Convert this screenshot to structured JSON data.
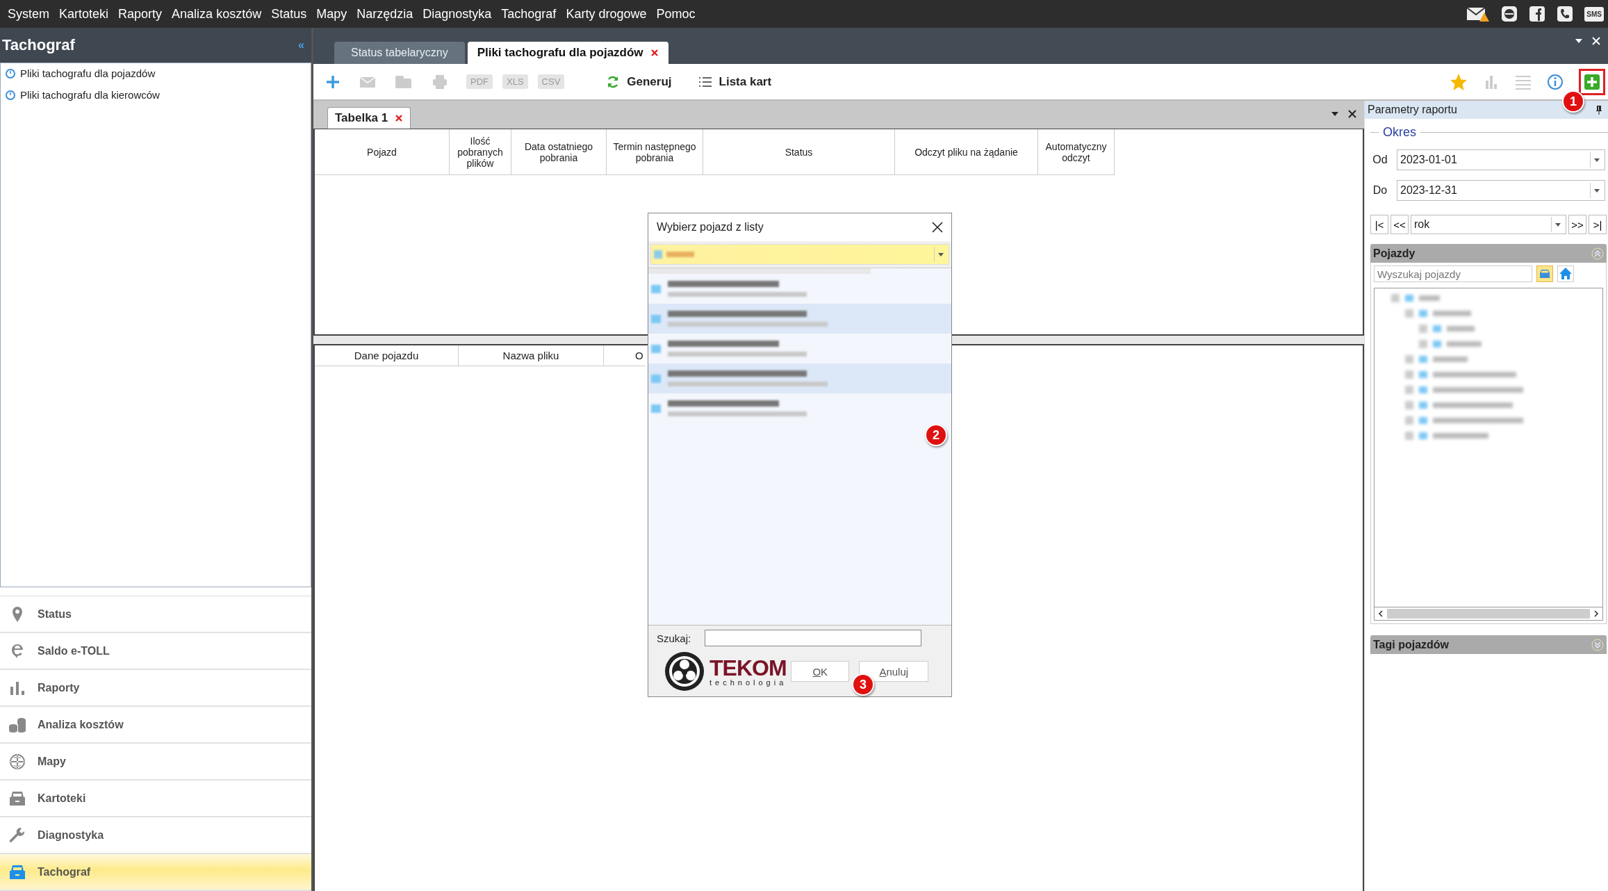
{
  "menu": [
    {
      "label": "System"
    },
    {
      "label": "Kartoteki"
    },
    {
      "label": "Raporty"
    },
    {
      "label": "Analiza kosztów"
    },
    {
      "label": "Status"
    },
    {
      "label": "Mapy"
    },
    {
      "label": "Narzędzia"
    },
    {
      "label": "Diagnostyka"
    },
    {
      "label": "Tachograf"
    },
    {
      "label": "Karty drogowe"
    },
    {
      "label": "Pomoc"
    }
  ],
  "sms_label": "SMS",
  "left_panel": {
    "title": "Tachograf",
    "collapse": "«",
    "items": [
      {
        "label": "Pliki tachografu dla pojazdów"
      },
      {
        "label": "Pliki tachografu dla kierowców"
      }
    ]
  },
  "nav": [
    {
      "label": "Status",
      "selected": false
    },
    {
      "label": "Saldo e-TOLL",
      "selected": false
    },
    {
      "label": "Raporty",
      "selected": false
    },
    {
      "label": "Analiza kosztów",
      "selected": false
    },
    {
      "label": "Mapy",
      "selected": false
    },
    {
      "label": "Kartoteki",
      "selected": false
    },
    {
      "label": "Diagnostyka",
      "selected": false
    },
    {
      "label": "Tachograf",
      "selected": true
    }
  ],
  "doc_tabs": [
    {
      "label": "Status tabelaryczny",
      "selected": false,
      "closable": false
    },
    {
      "label": "Pliki tachografu dla pojazdów",
      "selected": true,
      "closable": true
    }
  ],
  "toolbar": {
    "exports": [
      "PDF",
      "XLS",
      "CSV"
    ],
    "generate": "Generuj",
    "card_list": "Lista kart"
  },
  "table_tabs": [
    {
      "label": "Tabelka 1",
      "selected": true
    }
  ],
  "table": {
    "columns": [
      "Pojazd",
      "Ilość pobranych plików",
      "Data ostatniego pobrania",
      "Termin następnego pobrania",
      "Status",
      "Odczyt pliku na żądanie",
      "Automatyczny odczyt"
    ]
  },
  "lower_table": {
    "columns": [
      "Dane pojazdu",
      "Nazwa pliku",
      "O"
    ]
  },
  "dialog": {
    "title": "Wybierz pojazd z listy",
    "rows": [
      {
        "selected": false
      },
      {
        "selected": true
      },
      {
        "selected": false
      },
      {
        "selected": true
      },
      {
        "selected": false
      }
    ],
    "search_label": "Szukaj:",
    "logo": "TEKOM",
    "logo_sub": "technologia",
    "ok": "OK",
    "cancel": "Anuluj"
  },
  "params": {
    "title": "Parametry raportu",
    "group": "Okres",
    "from_label": "Od",
    "from": "2023-01-01",
    "to_label": "Do",
    "to": "2023-12-31",
    "period": "rok",
    "nav_buttons": [
      "|<",
      "<<",
      ">>",
      ">|"
    ]
  },
  "vehicles": {
    "title": "Pojazdy",
    "placeholder": "Wyszukaj pojazdy"
  },
  "tags": {
    "title": "Tagi pojazdów"
  },
  "callouts": [
    {
      "label": "1"
    },
    {
      "label": "2"
    },
    {
      "label": "3"
    }
  ]
}
